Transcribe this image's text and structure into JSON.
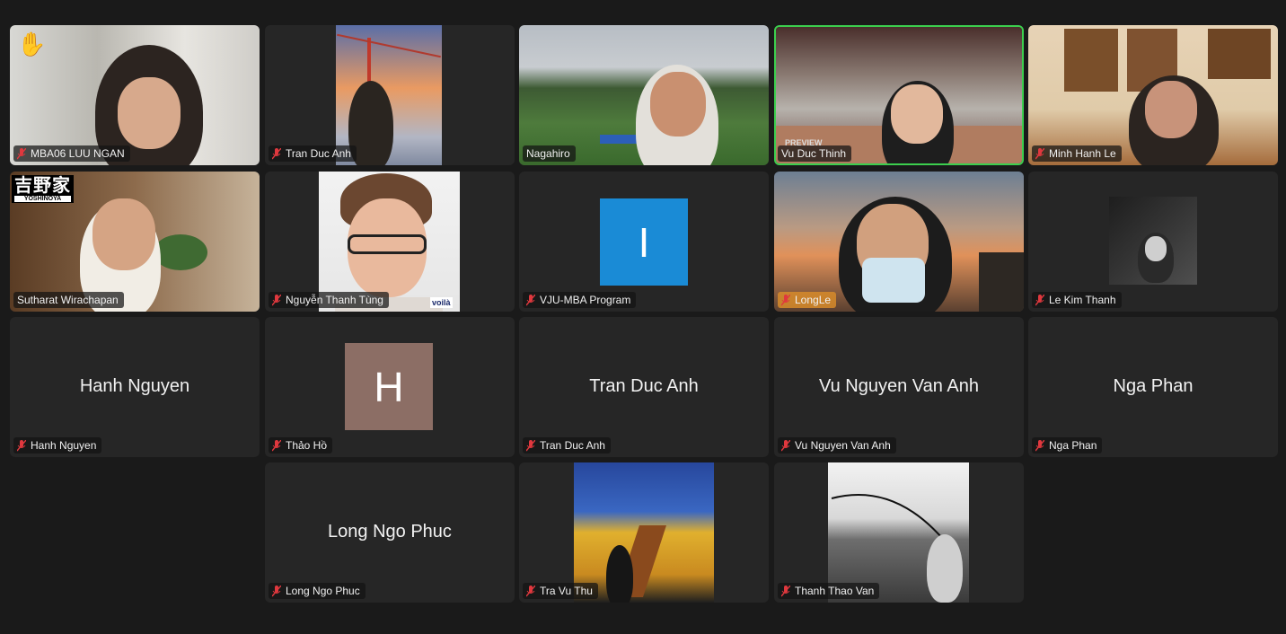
{
  "meeting": {
    "participants": [
      {
        "name": "MBA06 LUU NGAN",
        "muted": true,
        "hand_raised": true
      },
      {
        "name": "Tran Duc Anh",
        "muted": true
      },
      {
        "name": "Nagahiro",
        "muted": false
      },
      {
        "name": "Vu Duc Thinh",
        "muted": false,
        "active_speaker": true
      },
      {
        "name": "Minh Hanh Le",
        "muted": true
      },
      {
        "name": "Sutharat Wirachapan",
        "muted": false,
        "logo_text": "YOSHINOYA",
        "logo_kanji": "吉野家"
      },
      {
        "name": "Nguyễn Thanh Tùng",
        "muted": true,
        "watermark": "voilà"
      },
      {
        "name": "VJU-MBA Program",
        "muted": true,
        "avatar_letter": "I",
        "avatar_color": "#1a8bd6"
      },
      {
        "name": "LongLe",
        "muted": true,
        "highlight_color": "#d78b2a"
      },
      {
        "name": "Le Kim Thanh",
        "muted": true
      },
      {
        "name": "Hanh Nguyen",
        "muted": true,
        "display_name": "Hanh Nguyen"
      },
      {
        "name": "Thảo Hồ",
        "muted": true,
        "avatar_letter": "H",
        "avatar_color": "#8c6e65"
      },
      {
        "name": "Tran Duc Anh",
        "muted": true,
        "display_name": "Tran Duc Anh"
      },
      {
        "name": "Vu Nguyen Van Anh",
        "muted": true,
        "display_name": "Vu Nguyen Van Anh"
      },
      {
        "name": "Nga Phan",
        "muted": true,
        "display_name": "Nga Phan"
      },
      {
        "name": "Long Ngo Phuc",
        "muted": true,
        "display_name": "Long Ngo Phuc"
      },
      {
        "name": "Tra Vu Thu",
        "muted": true
      },
      {
        "name": "Thanh Thao Van",
        "muted": true
      }
    ],
    "colors": {
      "background": "#1a1a1a",
      "tile": "#262626",
      "active_speaker_border": "#3ccf4e",
      "muted_icon": "#e0383e"
    },
    "icons": {
      "muted": "mic-muted-icon",
      "hand": "raised-hand-icon"
    }
  }
}
